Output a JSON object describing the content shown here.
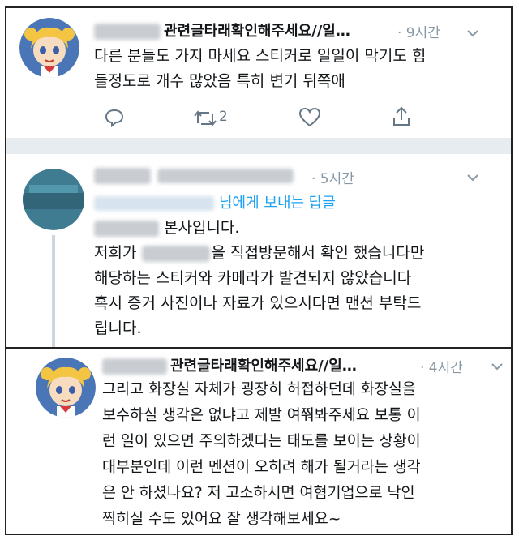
{
  "tweets": [
    {
      "title": "관련글타래확인해주세요//일…",
      "time": "· 9시간",
      "text_lines": [
        "다른 분들도 가지 마세요 스티커로 일일이 막기도 힘",
        "들정도로 개수 많았음 특히 변기 뒤쪽애"
      ],
      "retweet_count": "2"
    },
    {
      "time": "· 5시간",
      "reply_suffix": "님에게 보내는 답글",
      "line1_suffix": "본사입니다.",
      "line2_prefix": "저희가",
      "line2_suffix": "을 직접방문해서 확인 했습니다만",
      "text_lines": [
        "해당하는 스티커와 카메라가 발견되지 않았습니다",
        "혹시 증거 사진이나 자료가 있으시다면 맨션 부탁드",
        "립니다."
      ]
    },
    {
      "title": "관련글타래확인해주세요//일…",
      "time": "· 4시간",
      "text_lines": [
        "그리고 화장실 자체가 굉장히 허접하던데 화장실을",
        "보수하실 생각은 없냐고 제발 여쭤봐주세요 보통 이",
        "런 일이 있으면 주의하겠다는 태도를 보이는 상황이",
        "대부분인데 이런 멘션이 오히려 해가 될거라는 생각",
        "은 안 하셨나요? 저  고소하시면 여혐기업으로 낙인",
        "찍히실 수도 있어요 잘 생각해보세요~"
      ]
    }
  ],
  "icons": {
    "reply": "reply-icon",
    "retweet": "retweet-icon",
    "like": "heart-icon",
    "share": "share-icon",
    "menu": "chevron-down-icon"
  }
}
